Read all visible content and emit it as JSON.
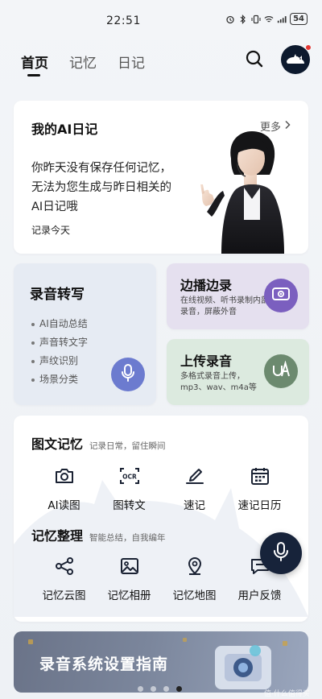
{
  "status_bar": {
    "time": "22:51",
    "battery": "54"
  },
  "nav": {
    "tabs": [
      {
        "label": "首页",
        "active": true
      },
      {
        "label": "记忆",
        "active": false
      },
      {
        "label": "日记",
        "active": false
      }
    ],
    "search_icon": "search-icon",
    "avatar_icon": "cat-avatar"
  },
  "diary": {
    "title": "我的AI日记",
    "more_label": "更多",
    "message": "你昨天没有保存任何记忆，无法为您生成与昨日相关的AI日记哦",
    "action": "记录今天"
  },
  "record": {
    "title": "录音转写",
    "features": [
      "AI自动总结",
      "声音转文字",
      "声纹识别",
      "场景分类"
    ],
    "icon": "mic-icon"
  },
  "broadcast": {
    "title": "边播边录",
    "desc": "在线视频、听书录制内部录音，屏蔽外音",
    "icon": "video-record-icon",
    "color": "#7b5fbf"
  },
  "upload": {
    "title": "上传录音",
    "desc": "多格式录音上传，mp3、wav、m4a等",
    "icon": "upload-audio-icon",
    "color": "#6c8a6f"
  },
  "graphic_memory": {
    "title": "图文记忆",
    "subtitle": "记录日常，留住瞬间",
    "items": [
      {
        "label": "AI读图",
        "icon": "camera-icon"
      },
      {
        "label": "图转文",
        "icon": "ocr-icon"
      },
      {
        "label": "速记",
        "icon": "pen-icon"
      },
      {
        "label": "速记日历",
        "icon": "calendar-icon"
      }
    ]
  },
  "memory_organize": {
    "title": "记忆整理",
    "subtitle": "智能总结，自我编年",
    "items": [
      {
        "label": "记忆云图",
        "icon": "share-graph-icon"
      },
      {
        "label": "记忆相册",
        "icon": "image-icon"
      },
      {
        "label": "记忆地图",
        "icon": "map-pin-icon"
      },
      {
        "label": "用户反馈",
        "icon": "feedback-icon"
      }
    ]
  },
  "fab": {
    "icon": "mic-icon"
  },
  "banner": {
    "text": "录音系统设置指南",
    "page_count": 4,
    "current_page": 4,
    "watermark": "值·什么值得买"
  }
}
